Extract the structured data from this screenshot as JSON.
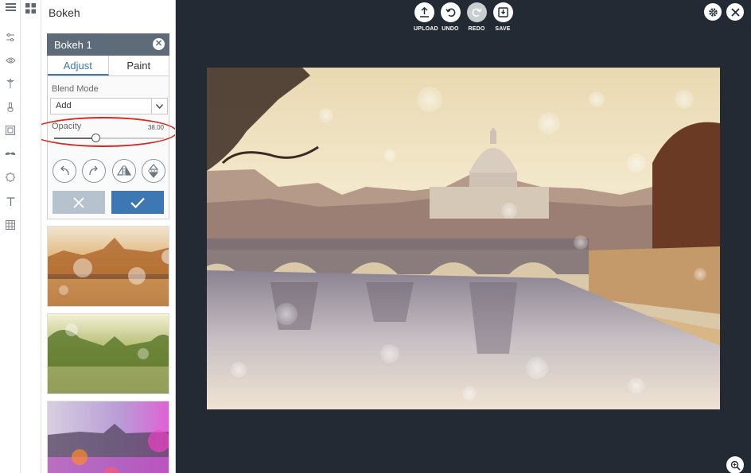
{
  "panel": {
    "title": "Bokeh",
    "layer_name": "Bokeh 1",
    "tabs": [
      {
        "label": "Adjust",
        "active": true
      },
      {
        "label": "Paint",
        "active": false
      }
    ],
    "blend_mode": {
      "label": "Blend Mode",
      "value": "Add"
    },
    "opacity": {
      "label": "Opacity",
      "value_text": "38.00",
      "value": 38
    }
  },
  "toolbar": {
    "upload": "UPLOAD",
    "undo": "UNDO",
    "redo": "REDO",
    "save": "SAVE"
  },
  "colors": {
    "accent": "#3d78b4",
    "canvas_bg": "#232a33",
    "highlight": "#d52a1f"
  }
}
